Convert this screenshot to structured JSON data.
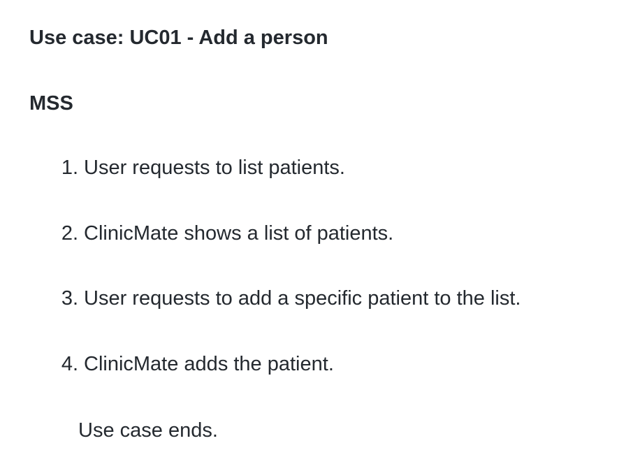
{
  "usecase": {
    "title": "Use case: UC01 - Add a person"
  },
  "mss": {
    "heading": "MSS",
    "steps": [
      {
        "num": "1.",
        "text": "User requests to list patients."
      },
      {
        "num": "2.",
        "text": "ClinicMate shows a list of patients."
      },
      {
        "num": "3.",
        "text": "User requests to add a specific patient to the list."
      },
      {
        "num": "4.",
        "text": "ClinicMate adds the patient."
      }
    ],
    "ending": "Use case ends."
  }
}
